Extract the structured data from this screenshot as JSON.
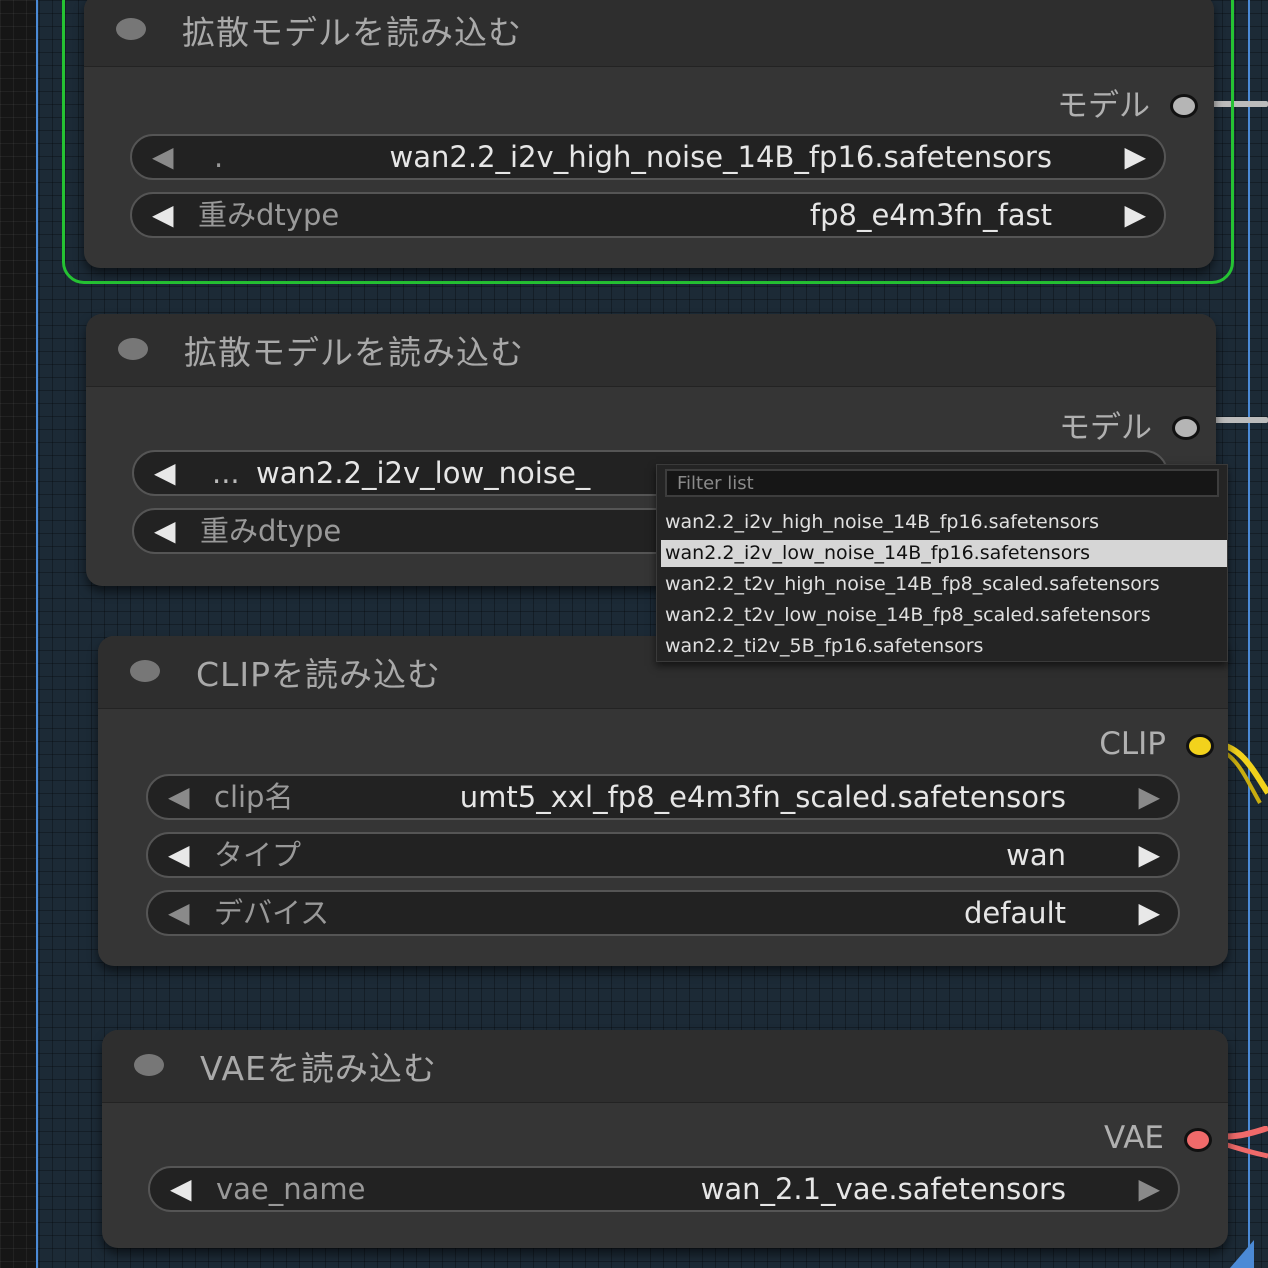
{
  "colors": {
    "selected_outline": "#25c233",
    "group_border": "#4b8ad6",
    "model_socket": "#b5b5b5",
    "clip_socket": "#f2d21c",
    "vae_socket": "#f06a6a"
  },
  "nodes": [
    {
      "title": "拡散モデルを読み込む",
      "output_label": "モデル",
      "widgets": [
        {
          "label": ".",
          "value": "wan2.2_i2v_high_noise_14B_fp16.safetensors"
        },
        {
          "label": "重みdtype",
          "value": "fp8_e4m3fn_fast"
        }
      ]
    },
    {
      "title": "拡散モデルを読み込む",
      "output_label": "モデル",
      "widgets": [
        {
          "label": "...",
          "value": "wan2.2_i2v_low_noise_"
        },
        {
          "label": "重みdtype",
          "value": ""
        }
      ]
    },
    {
      "title": "CLIPを読み込む",
      "output_label": "CLIP",
      "widgets": [
        {
          "label": "clip名",
          "value": "umt5_xxl_fp8_e4m3fn_scaled.safetensors"
        },
        {
          "label": "タイプ",
          "value": "wan"
        },
        {
          "label": "デバイス",
          "value": "default"
        }
      ]
    },
    {
      "title": "VAEを読み込む",
      "output_label": "VAE",
      "widgets": [
        {
          "label": "vae_name",
          "value": "wan_2.1_vae.safetensors"
        }
      ]
    }
  ],
  "dropdown": {
    "filter_placeholder": "Filter list",
    "options": [
      "wan2.2_i2v_high_noise_14B_fp16.safetensors",
      "wan2.2_i2v_low_noise_14B_fp16.safetensors",
      "wan2.2_t2v_high_noise_14B_fp8_scaled.safetensors",
      "wan2.2_t2v_low_noise_14B_fp8_scaled.safetensors",
      "wan2.2_ti2v_5B_fp16.safetensors"
    ],
    "selected_index": 1
  },
  "icons": {
    "arrow_left": "◀",
    "arrow_right": "▶"
  }
}
